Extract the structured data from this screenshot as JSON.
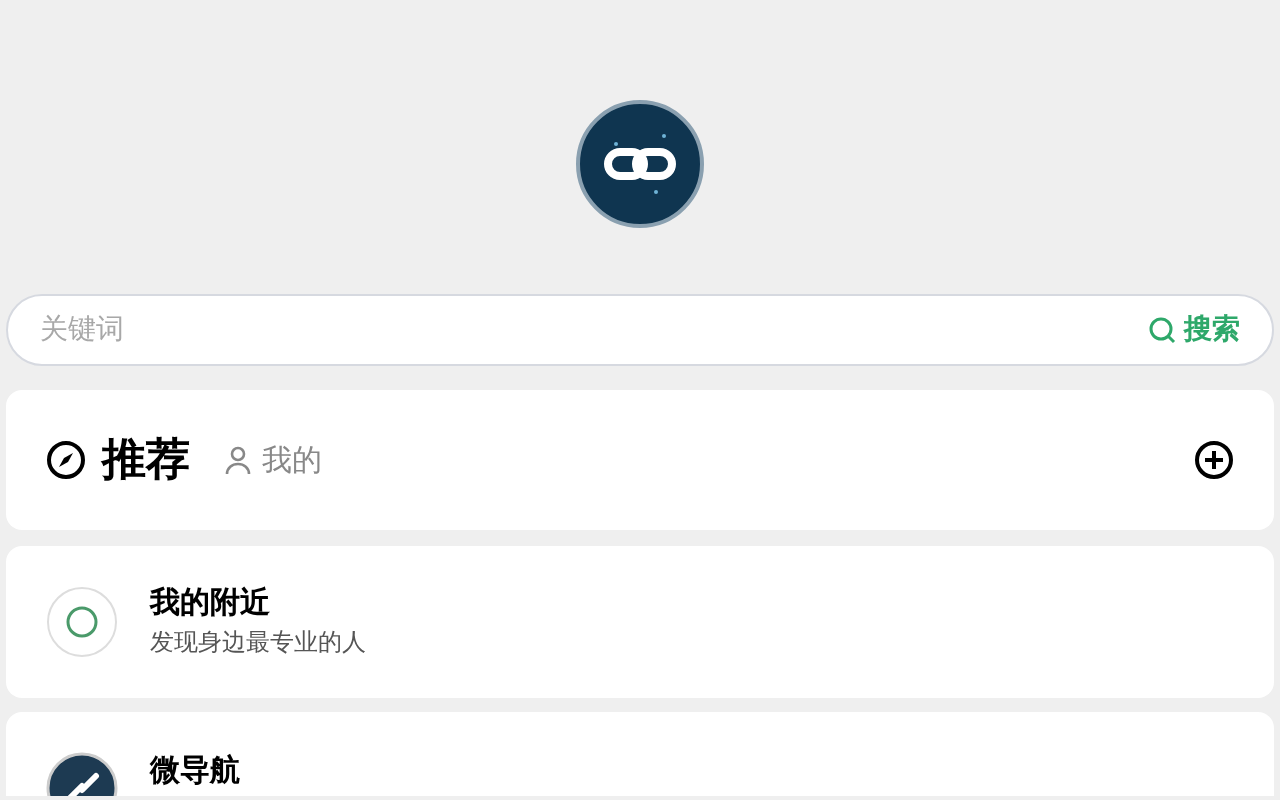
{
  "search": {
    "placeholder": "关键词",
    "button": "搜索"
  },
  "tabs": [
    {
      "label": "推荐",
      "selected": true
    },
    {
      "label": "我的",
      "selected": false
    }
  ],
  "items": [
    {
      "kind": "ring",
      "title": "我的附近",
      "subtitle": "发现身边最专业的人"
    },
    {
      "kind": "logo",
      "title": "微导航"
    }
  ]
}
